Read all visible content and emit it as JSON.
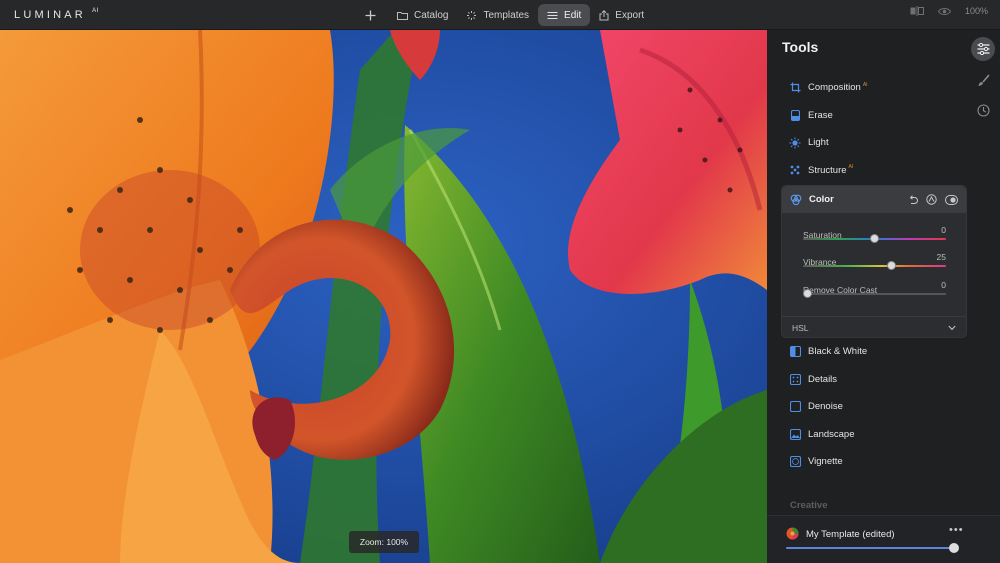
{
  "app": {
    "logo": "LUMINAR",
    "logo_sup": "AI"
  },
  "nav": {
    "add_label": "+",
    "items": [
      {
        "label": "Catalog",
        "icon": "folder-icon"
      },
      {
        "label": "Templates",
        "icon": "sparkle-icon"
      },
      {
        "label": "Edit",
        "icon": "sliders-icon",
        "active": true
      },
      {
        "label": "Export",
        "icon": "export-icon"
      }
    ]
  },
  "topright": {
    "zoom": "100%"
  },
  "canvas": {
    "zoom_label": "Zoom: 100%"
  },
  "panel": {
    "title": "Tools",
    "tools": [
      {
        "label": "Composition",
        "ai": "AI",
        "icon": "crop-icon"
      },
      {
        "label": "Erase",
        "ai": "",
        "icon": "eraser-icon"
      },
      {
        "label": "Light",
        "ai": "",
        "icon": "sun-icon"
      },
      {
        "label": "Structure",
        "ai": "AI",
        "icon": "structure-icon"
      }
    ],
    "color": {
      "label": "Color",
      "sliders": [
        {
          "label": "Saturation",
          "value": "0",
          "fraction": 0.5
        },
        {
          "label": "Vibrance",
          "value": "25",
          "fraction": 0.625
        },
        {
          "label": "Remove Color Cast",
          "value": "0",
          "fraction": 0.0
        }
      ],
      "hsl_label": "HSL"
    },
    "tools_after": [
      {
        "label": "Black & White",
        "icon": "bw-icon"
      },
      {
        "label": "Details",
        "icon": "details-icon"
      },
      {
        "label": "Denoise",
        "icon": "denoise-icon"
      },
      {
        "label": "Landscape",
        "icon": "landscape-icon"
      },
      {
        "label": "Vignette",
        "icon": "vignette-icon"
      }
    ],
    "section_creative": "Creative",
    "template": {
      "name": "My Template (edited)",
      "dots": "•••",
      "amount": 1.0
    }
  },
  "colors": {
    "accent": "#5b86d6",
    "tool_icon": "#4f8ee6",
    "ai_badge": "#e08a2c"
  }
}
